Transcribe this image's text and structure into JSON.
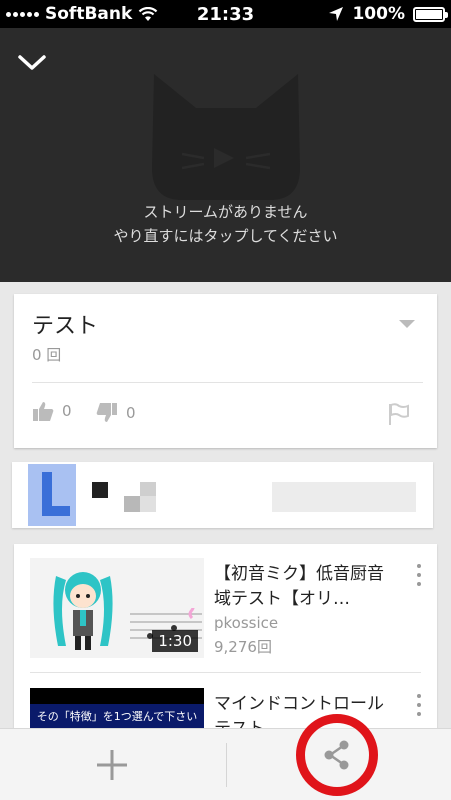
{
  "status_bar": {
    "carrier": "SoftBank",
    "time": "21:33",
    "battery": "100%"
  },
  "player": {
    "message_line1": "ストリームがありません",
    "message_line2": "やり直すにはタップしてください"
  },
  "video_info": {
    "title": "テスト",
    "views": "0 回",
    "likes": "0",
    "dislikes": "0"
  },
  "related": [
    {
      "title": "【初音ミク】低音厨音域テスト【オリ…",
      "channel": "pkossice",
      "views": "9,276回",
      "duration": "1:30"
    },
    {
      "title": "マインドコントロールテスト",
      "thumbnail_text": "その「特徴」を1つ選んで下さい"
    }
  ],
  "colors": {
    "player_bg": "#2b2b2b",
    "highlight_ring": "#e0141a"
  },
  "icons": [
    "collapse-chevron-icon",
    "cat-logo-icon",
    "thumbs-up-icon",
    "thumbs-down-icon",
    "flag-icon",
    "more-vert-icon",
    "add-icon",
    "share-icon"
  ]
}
